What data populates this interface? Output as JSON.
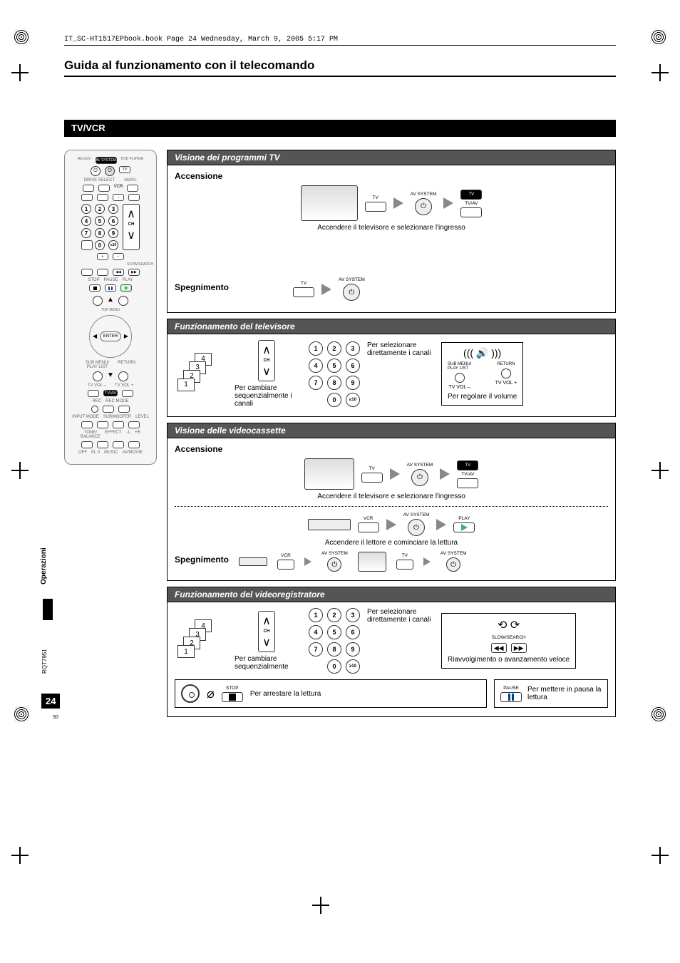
{
  "meta": {
    "book_info": "IT_SC-HT1517EPbook.book  Page 24  Wednesday, March 9, 2005  5:17 PM",
    "page_title": "Guida al funzionamento con il telecomando",
    "section": "TV/VCR",
    "side_tab": "Operazioni",
    "doc_code": "RQT7951",
    "page_number": "24",
    "sub_page": "50"
  },
  "remote": {
    "top_labels": {
      "receiv": "RECEIV",
      "av_system": "AV SYSTEM",
      "dvd": "DVD PLAYER",
      "tv": "TV"
    },
    "row2": {
      "drive": "DRIVE SELECT",
      "vcr": "VCR",
      "main": "-MAIN-"
    },
    "ch_label": "CH",
    "slow_search": "SLOW/SEARCH",
    "stop": "STOP",
    "pause": "PAUSE",
    "play": "PLAY",
    "top_menu": "TOP MENU",
    "enter": "ENTER",
    "sub_menu": "SUB MENU/\nPLAY LIST",
    "return": "RETURN",
    "tv_vol_m": "TV VOL –",
    "tv_vol_p": "TV VOL +",
    "tv_av": "TV/AV",
    "rec": "REC",
    "rec_mode": "REC MODE",
    "input": "INPUT MODE",
    "subwoofer": "SUBWOOFER",
    "level": "LEVEL",
    "tone": "TONE/\nBALANCE",
    "effect": "EFFECT",
    "off": "OFF",
    "pl2": "PL II",
    "music": "MUSIC",
    "avmovie": "AV/MOVIE"
  },
  "s1": {
    "header": "Visione dei programmi TV",
    "accensione": "Accensione",
    "tv": "TV",
    "av_system": "AV SYSTEM",
    "tv_av": "TV/AV",
    "tv_btn": "TV",
    "note": "Accendere il televisore e selezionare l'ingresso",
    "spegnimento": "Spegnimento"
  },
  "s2": {
    "header": "Funzionamento del televisore",
    "ch": "CH",
    "change_seq": "Per cambiare sequenzialmente i canali",
    "direct": "Per selezionare direttamente i canali",
    "sub_menu": "SUB MENU/\nPLAY LIST",
    "return": "RETURN",
    "tv_vol_m": "TV VOL –",
    "tv_vol_p": "TV VOL +",
    "vol_note": "Per regolare il volume"
  },
  "s3": {
    "header": "Visione delle videocassette",
    "accensione": "Accensione",
    "tv": "TV",
    "av_system": "AV SYSTEM",
    "tv_av": "TV/AV",
    "tv_btn": "TV",
    "note1": "Accendere il televisore e selezionare l'ingresso",
    "vcr": "VCR",
    "play": "PLAY",
    "note2": "Accendere il lettore e cominciare la lettura",
    "spegnimento": "Spegnimento"
  },
  "s4": {
    "header": "Funzionamento del videoregistratore",
    "ch": "CH",
    "change_seq": "Per cambiare sequenzialmente",
    "direct": "Per selezionare direttamente i canali",
    "slow_search": "SLOW/SEARCH",
    "rewind_note": "Riavvolgimento o avanzamento veloce",
    "stop": "STOP",
    "stop_note": "Per arrestare la lettura",
    "pause": "PAUSE",
    "pause_note": "Per mettere in pausa la lettura"
  }
}
